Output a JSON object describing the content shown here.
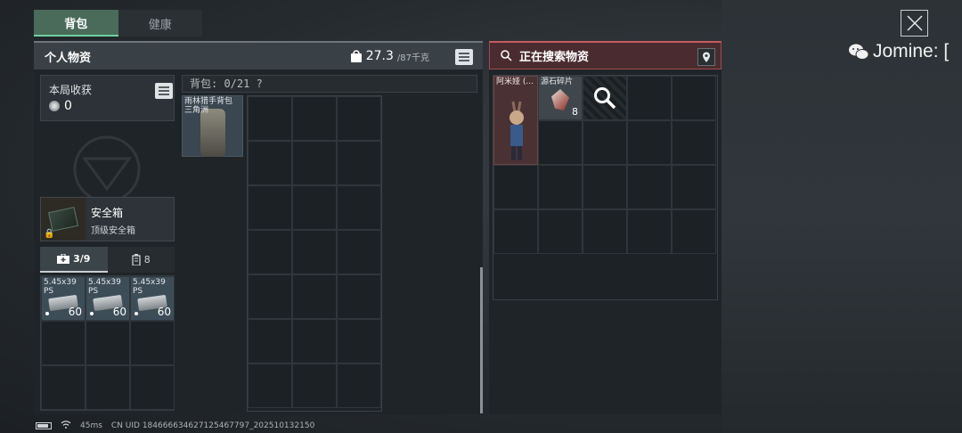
{
  "tabs": [
    {
      "label": "背包"
    },
    {
      "label": "健康"
    }
  ],
  "watermark": {
    "text": "Jomine: [",
    "icon": "wechat-icon"
  },
  "left_panel": {
    "title": "个人物资",
    "weight_current": "27.3",
    "weight_max": "/87千克"
  },
  "harvest": {
    "label": "本局收获",
    "value": "0"
  },
  "safebox": {
    "name": "安全箱",
    "subtitle": "顶级安全箱"
  },
  "subtabs": [
    {
      "label": "3/9"
    },
    {
      "label": "8"
    }
  ],
  "ammo": [
    {
      "name": "5.45x39 PS",
      "count": "60"
    },
    {
      "name": "5.45x39 PS",
      "count": "60"
    },
    {
      "name": "5.45x39 PS",
      "count": "60"
    }
  ],
  "backpack": {
    "label": "背包: 0/21  ?",
    "item_name": "雨林猎手背包 三角洲"
  },
  "search_panel": {
    "title": "正在搜索物资",
    "items": [
      {
        "name": "阿米娅 (...",
        "accent": "#4a3234"
      },
      {
        "name": "源石碎片",
        "count": "8"
      }
    ]
  },
  "status": {
    "ping": "45ms",
    "uid": "CN UID 184666634627125467797_202510132150"
  }
}
